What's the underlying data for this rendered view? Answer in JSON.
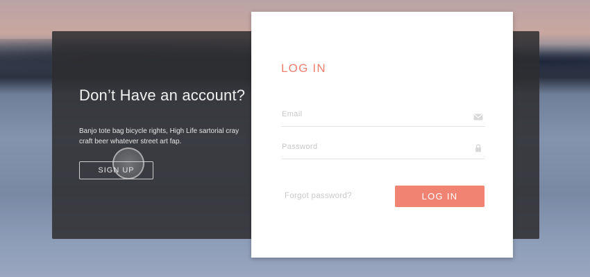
{
  "promo": {
    "title": "Don’t Have an account?",
    "text": "Banjo tote bag bicycle rights, High Life sartorial cray craft beer whatever street art fap.",
    "signup_label": "SIGN UP"
  },
  "login": {
    "title": "LOG IN",
    "email_placeholder": "Email",
    "password_placeholder": "Password",
    "forgot_label": "Forgot password?",
    "submit_label": "LOG IN"
  },
  "icons": {
    "email": "envelope-icon",
    "password": "lock-icon"
  },
  "colors": {
    "accent": "#f08372",
    "title_accent": "#ef7f6d",
    "panel": "#2d2d30"
  }
}
